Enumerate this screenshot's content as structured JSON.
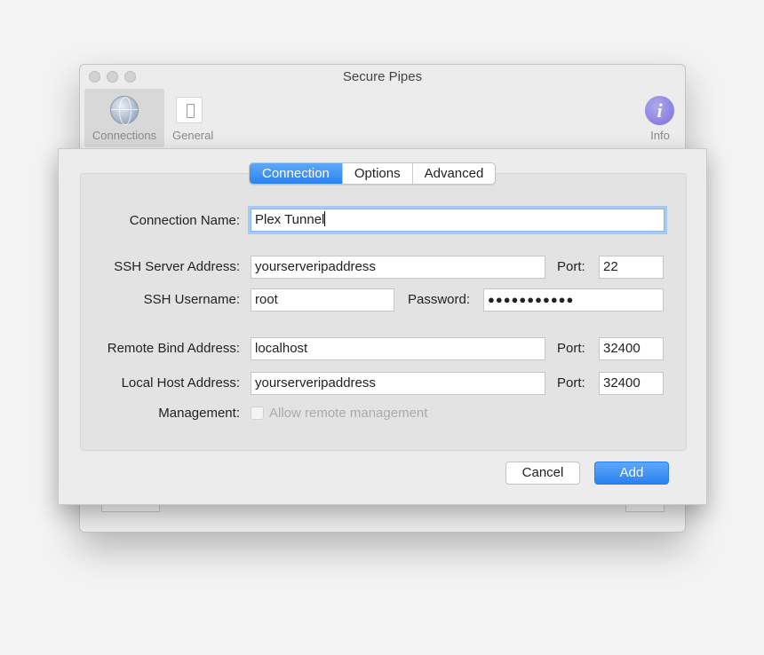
{
  "window": {
    "title": "Secure Pipes",
    "toolbar": {
      "connections_label": "Connections",
      "general_label": "General",
      "info_label": "Info"
    }
  },
  "sheet": {
    "tabs": [
      "Connection",
      "Options",
      "Advanced"
    ],
    "selected_tab": "Connection",
    "fields": {
      "connection_name": {
        "label": "Connection Name:",
        "value": "Plex Tunnel"
      },
      "ssh_server": {
        "label": "SSH Server Address:",
        "value": "yourserveripaddress"
      },
      "ssh_port": {
        "label": "Port:",
        "value": "22"
      },
      "ssh_username": {
        "label": "SSH Username:",
        "value": "root"
      },
      "password": {
        "label": "Password:",
        "value": "●●●●●●●●●●●"
      },
      "remote_bind": {
        "label": "Remote Bind Address:",
        "value": "localhost"
      },
      "remote_port": {
        "label": "Port:",
        "value": "32400"
      },
      "local_host": {
        "label": "Local Host Address:",
        "value": "yourserveripaddress"
      },
      "local_port": {
        "label": "Port:",
        "value": "32400"
      },
      "management": {
        "label": "Management:",
        "checkbox_label": "Allow remote management",
        "checked": false
      }
    },
    "buttons": {
      "cancel": "Cancel",
      "add": "Add"
    }
  },
  "icons": {
    "connections": "globe-icon",
    "general": "switch-icon",
    "info": "info-icon"
  },
  "colors": {
    "accent": "#2a82f0",
    "focus_ring": "#a9c9f5",
    "info_icon": "#7a6fd8"
  }
}
